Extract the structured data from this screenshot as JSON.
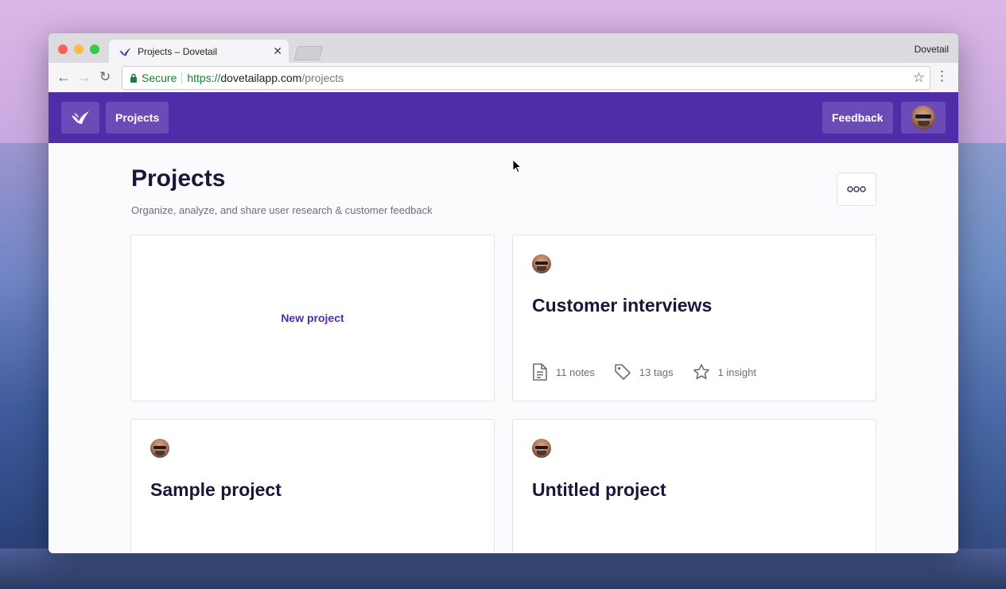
{
  "browser": {
    "tab_title": "Projects – Dovetail",
    "window_label": "Dovetail",
    "secure_label": "Secure",
    "url_scheme": "https://",
    "url_host": "dovetailapp.com",
    "url_path": "/projects"
  },
  "appbar": {
    "projects_label": "Projects",
    "feedback_label": "Feedback",
    "brand_color": "#4f2ca8"
  },
  "page": {
    "title": "Projects",
    "subtitle": "Organize, analyze, and share user research & customer feedback",
    "more_icon": "ellipsis-icon"
  },
  "new_project": {
    "label": "New project"
  },
  "projects": [
    {
      "title": "Customer interviews",
      "notes": "11 notes",
      "tags": "13 tags",
      "insights": "1 insight"
    },
    {
      "title": "Sample project"
    },
    {
      "title": "Untitled project"
    }
  ]
}
